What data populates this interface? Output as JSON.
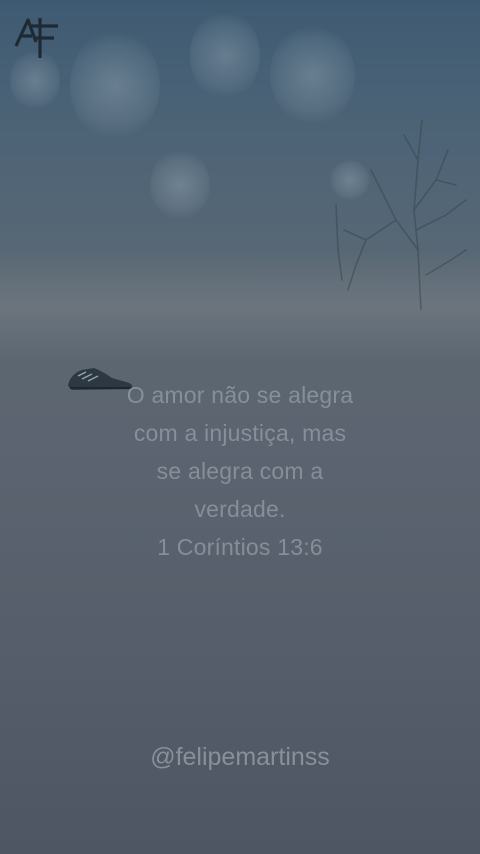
{
  "overlay": {
    "logo_icon": "af-monogram-icon",
    "quote": {
      "lines": [
        "O amor não se alegra",
        "com a injustiça, mas",
        "se alegra com a",
        "verdade."
      ],
      "reference": "1 Coríntios 13:6"
    },
    "handle": "@felipemartinss"
  },
  "colors": {
    "text": "#969ea6",
    "sky": "#3e5a72",
    "ground": "#565e6b"
  }
}
